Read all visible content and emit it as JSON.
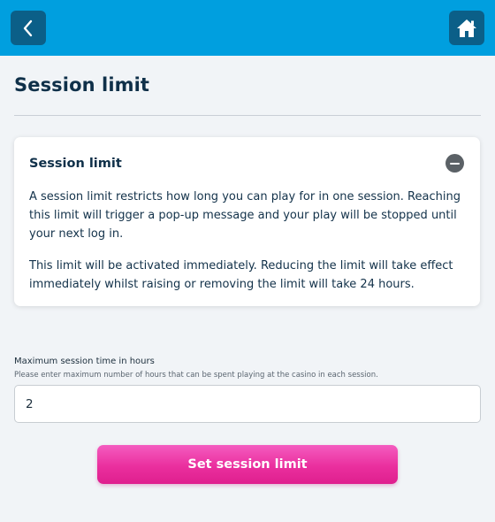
{
  "header": {
    "background_color": "#009fdf",
    "button_color": "#0b5f88",
    "back_icon": "chevron-left-icon",
    "home_icon": "home-icon"
  },
  "page": {
    "title": "Session limit"
  },
  "info_card": {
    "title": "Session limit",
    "collapse_icon": "minus-circle-icon",
    "paragraph_1": "A session limit restricts how long you can play for in one session. Reaching this limit will trigger a pop-up message and your play will be stopped until your next log in.",
    "paragraph_2": "This limit will be activated immediately. Reducing the limit will take effect immediately whilst raising or removing the limit will take 24 hours."
  },
  "form": {
    "label": "Maximum session time in hours",
    "hint": "Please enter maximum number of hours that can be spent playing at the casino in each session.",
    "value": "2",
    "submit_label": "Set session limit",
    "submit_color": "#ea2f9e"
  }
}
